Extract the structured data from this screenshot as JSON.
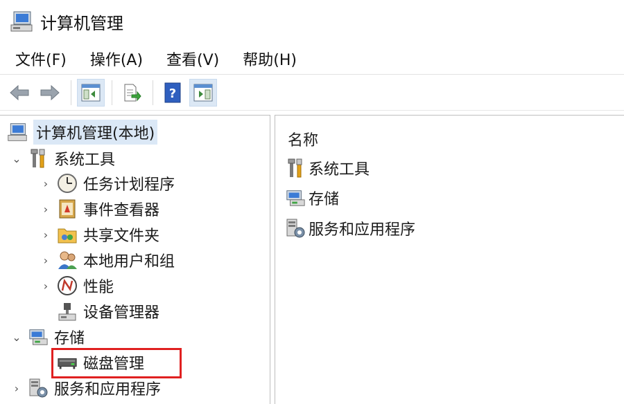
{
  "window": {
    "title": "计算机管理"
  },
  "menu": [
    "文件(F)",
    "操作(A)",
    "查看(V)",
    "帮助(H)"
  ],
  "tree": {
    "root": "计算机管理(本地)",
    "system_tools": "系统工具",
    "task_scheduler": "任务计划程序",
    "event_viewer": "事件查看器",
    "shared_folders": "共享文件夹",
    "local_users": "本地用户和组",
    "performance": "性能",
    "device_manager": "设备管理器",
    "storage": "存储",
    "disk_management": "磁盘管理",
    "services_apps": "服务和应用程序"
  },
  "list": {
    "header": "名称",
    "items": [
      "系统工具",
      "存储",
      "服务和应用程序"
    ]
  },
  "colors": {
    "selection": "#dbe8f6",
    "highlight_border": "#e02020"
  },
  "icons": [
    "computer-management-icon",
    "back-arrow-icon",
    "forward-arrow-icon",
    "show-hide-console-tree-icon",
    "export-list-icon",
    "help-icon",
    "show-hide-action-pane-icon"
  ]
}
